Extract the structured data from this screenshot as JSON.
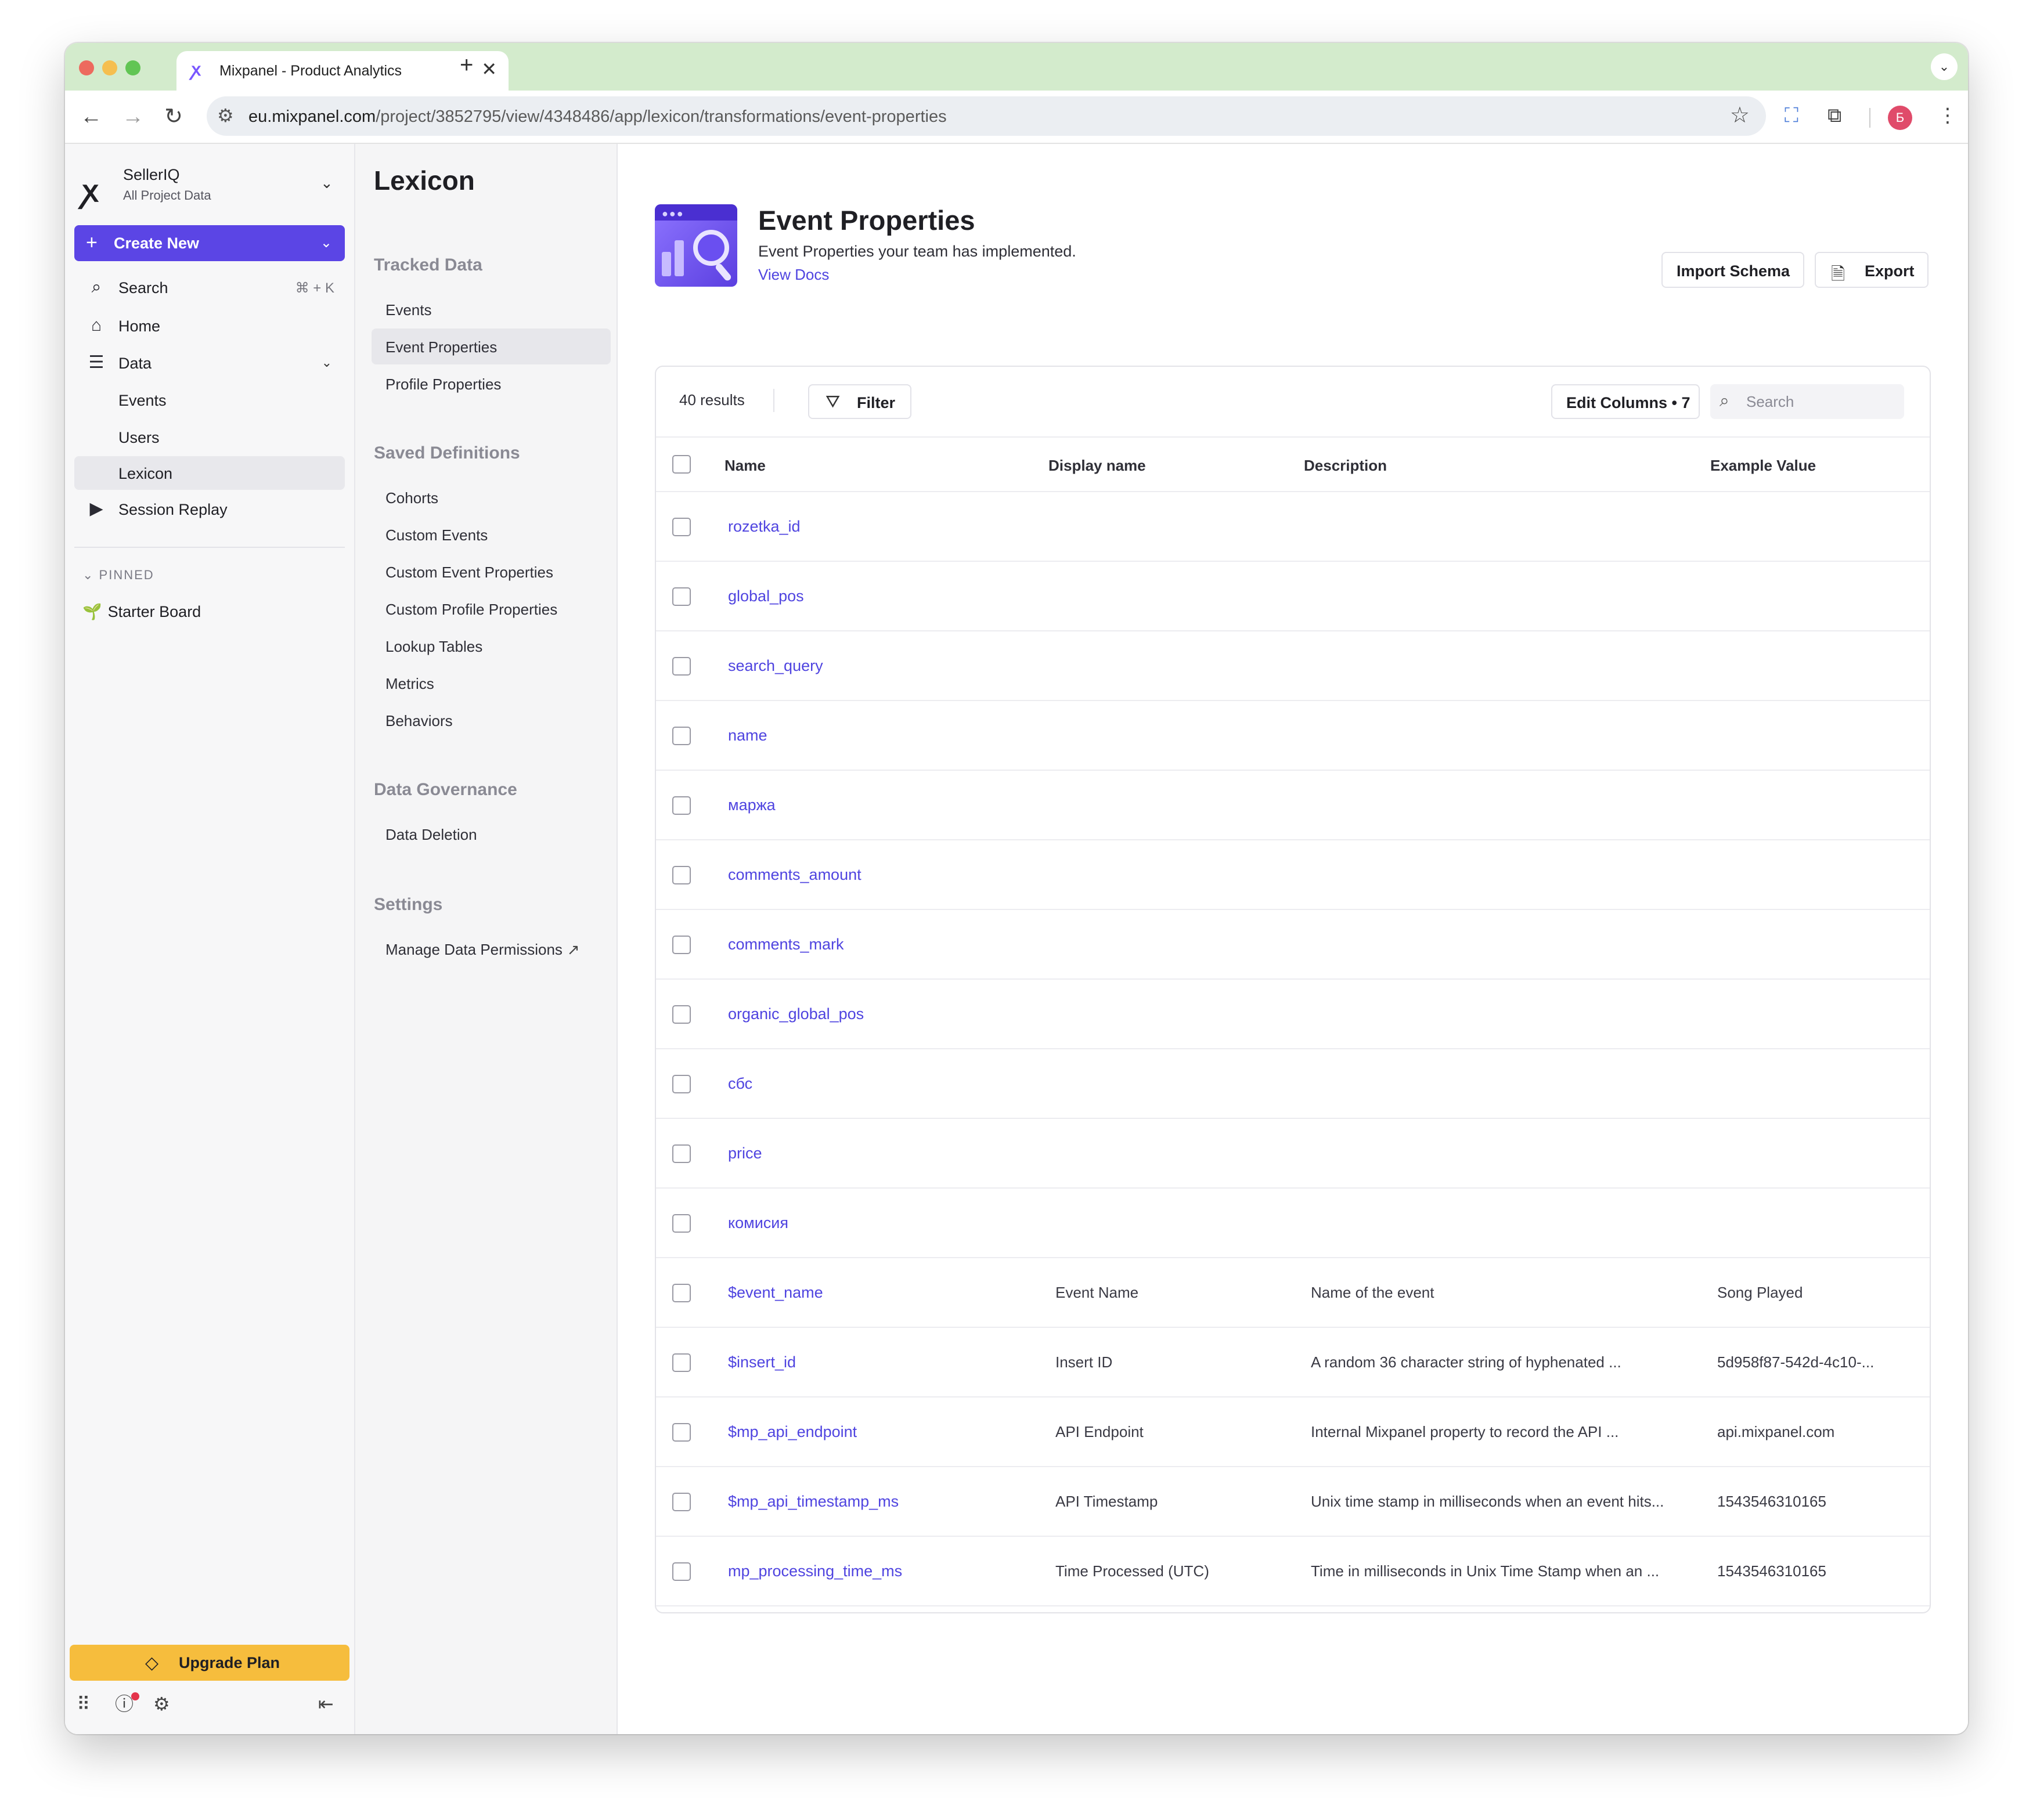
{
  "browser": {
    "tab_title": "Mixpanel - Product Analytics",
    "tab_close": "✕",
    "new_tab": "+",
    "url_host": "eu.mixpanel.com",
    "url_path": "/project/3852795/view/4348486/app/lexicon/transformations/event-properties",
    "profile_initial": "Б"
  },
  "sidebar": {
    "org_name": "SellerIQ",
    "org_sub": "All Project Data",
    "create_new": "Create New",
    "search": {
      "label": "Search",
      "shortcut": "⌘ + K"
    },
    "items": {
      "home": "Home",
      "data": "Data",
      "events": "Events",
      "users": "Users",
      "lexicon": "Lexicon",
      "session_replay": "Session Replay"
    },
    "pinned_label": "PINNED",
    "pinned_items": [
      "Starter Board"
    ],
    "upgrade": "Upgrade Plan"
  },
  "lexicon_nav": {
    "title": "Lexicon",
    "sections": {
      "tracked_data": {
        "title": "Tracked Data",
        "items": [
          "Events",
          "Event Properties",
          "Profile Properties"
        ]
      },
      "saved_definitions": {
        "title": "Saved Definitions",
        "items": [
          "Cohorts",
          "Custom Events",
          "Custom Event Properties",
          "Custom Profile Properties",
          "Lookup Tables",
          "Metrics",
          "Behaviors"
        ]
      },
      "data_governance": {
        "title": "Data Governance",
        "items": [
          "Data Deletion"
        ]
      },
      "settings": {
        "title": "Settings",
        "items": [
          "Manage Data Permissions"
        ]
      }
    }
  },
  "main": {
    "title": "Event Properties",
    "subtitle": "Event Properties your team has implemented.",
    "view_docs": "View Docs",
    "import_schema": "Import Schema",
    "export": "Export",
    "results_count": "40 results",
    "filter": "Filter",
    "edit_columns": "Edit Columns • 7",
    "search_placeholder": "Search",
    "columns": [
      "Name",
      "Display name",
      "Description",
      "Example Value"
    ],
    "rows": [
      {
        "name": "rozetka_id",
        "display": "",
        "description": "",
        "example": ""
      },
      {
        "name": "global_pos",
        "display": "",
        "description": "",
        "example": ""
      },
      {
        "name": "search_query",
        "display": "",
        "description": "",
        "example": ""
      },
      {
        "name": "name",
        "display": "",
        "description": "",
        "example": ""
      },
      {
        "name": "маржа",
        "display": "",
        "description": "",
        "example": ""
      },
      {
        "name": "comments_amount",
        "display": "",
        "description": "",
        "example": ""
      },
      {
        "name": "comments_mark",
        "display": "",
        "description": "",
        "example": ""
      },
      {
        "name": "organic_global_pos",
        "display": "",
        "description": "",
        "example": ""
      },
      {
        "name": "сбс",
        "display": "",
        "description": "",
        "example": ""
      },
      {
        "name": "price",
        "display": "",
        "description": "",
        "example": ""
      },
      {
        "name": "комисия",
        "display": "",
        "description": "",
        "example": ""
      },
      {
        "name": "$event_name",
        "display": "Event Name",
        "description": "Name of the event",
        "example": "Song Played"
      },
      {
        "name": "$insert_id",
        "display": "Insert ID",
        "description": "A random 36 character string of hyphenated ...",
        "example": "5d958f87-542d-4c10-..."
      },
      {
        "name": "$mp_api_endpoint",
        "display": "API Endpoint",
        "description": "Internal Mixpanel property to record the API ...",
        "example": "api.mixpanel.com"
      },
      {
        "name": "$mp_api_timestamp_ms",
        "display": "API Timestamp",
        "description": "Unix time stamp in milliseconds when an event hits...",
        "example": "1543546310165"
      },
      {
        "name": "mp_processing_time_ms",
        "display": "Time Processed (UTC)",
        "description": "Time in milliseconds in Unix Time Stamp when an ...",
        "example": "1543546310165"
      }
    ]
  },
  "colors": {
    "accent": "#5b45e5",
    "link": "#4f44e0",
    "upgrade": "#f6bd3d",
    "browser_chrome": "#d3ebcc"
  }
}
